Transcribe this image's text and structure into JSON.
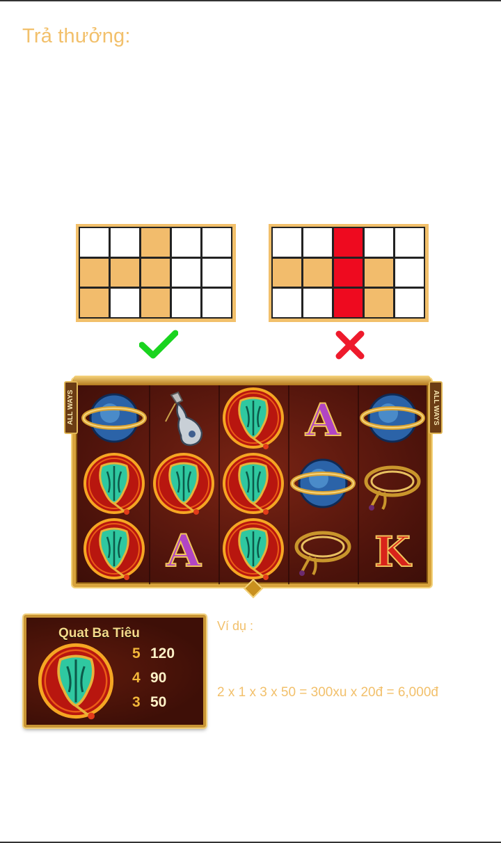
{
  "page": {
    "title": "Trả thưởng:"
  },
  "patterns": {
    "valid": {
      "rows": [
        [
          "w",
          "w",
          "o",
          "w",
          "w"
        ],
        [
          "o",
          "o",
          "o",
          "w",
          "w"
        ],
        [
          "o",
          "w",
          "o",
          "w",
          "w"
        ]
      ],
      "result_icon": "check-icon"
    },
    "invalid": {
      "rows": [
        [
          "w",
          "w",
          "r",
          "w",
          "w"
        ],
        [
          "o",
          "o",
          "r",
          "o",
          "w"
        ],
        [
          "w",
          "w",
          "r",
          "o",
          "w"
        ]
      ],
      "result_icon": "cross-icon"
    }
  },
  "reels": {
    "side_label": "ALL WAYS",
    "columns": [
      [
        "orb",
        "fan",
        "fan"
      ],
      [
        "gourd",
        "fan",
        "letter-a"
      ],
      [
        "fan",
        "fan",
        "fan"
      ],
      [
        "letter-a",
        "orb",
        "rope"
      ],
      [
        "orb",
        "rope",
        "letter-k"
      ]
    ],
    "letters": {
      "a": "A",
      "k": "K"
    }
  },
  "paytable": {
    "symbol_name": "Quat Ba Tiêu",
    "rows": [
      {
        "count": "5",
        "payout": "120"
      },
      {
        "count": "4",
        "payout": "90"
      },
      {
        "count": "3",
        "payout": "50"
      }
    ]
  },
  "example": {
    "label": "Ví dụ :",
    "formula": "2 x 1 x 3 x 50 = 300xu x 20đ = 6,000đ"
  },
  "colors": {
    "accent": "#f2c06b",
    "highlight": "#f2bc6c",
    "invalid": "#ee0a1f",
    "check": "#19d41f",
    "cross": "#ee1a2c"
  }
}
